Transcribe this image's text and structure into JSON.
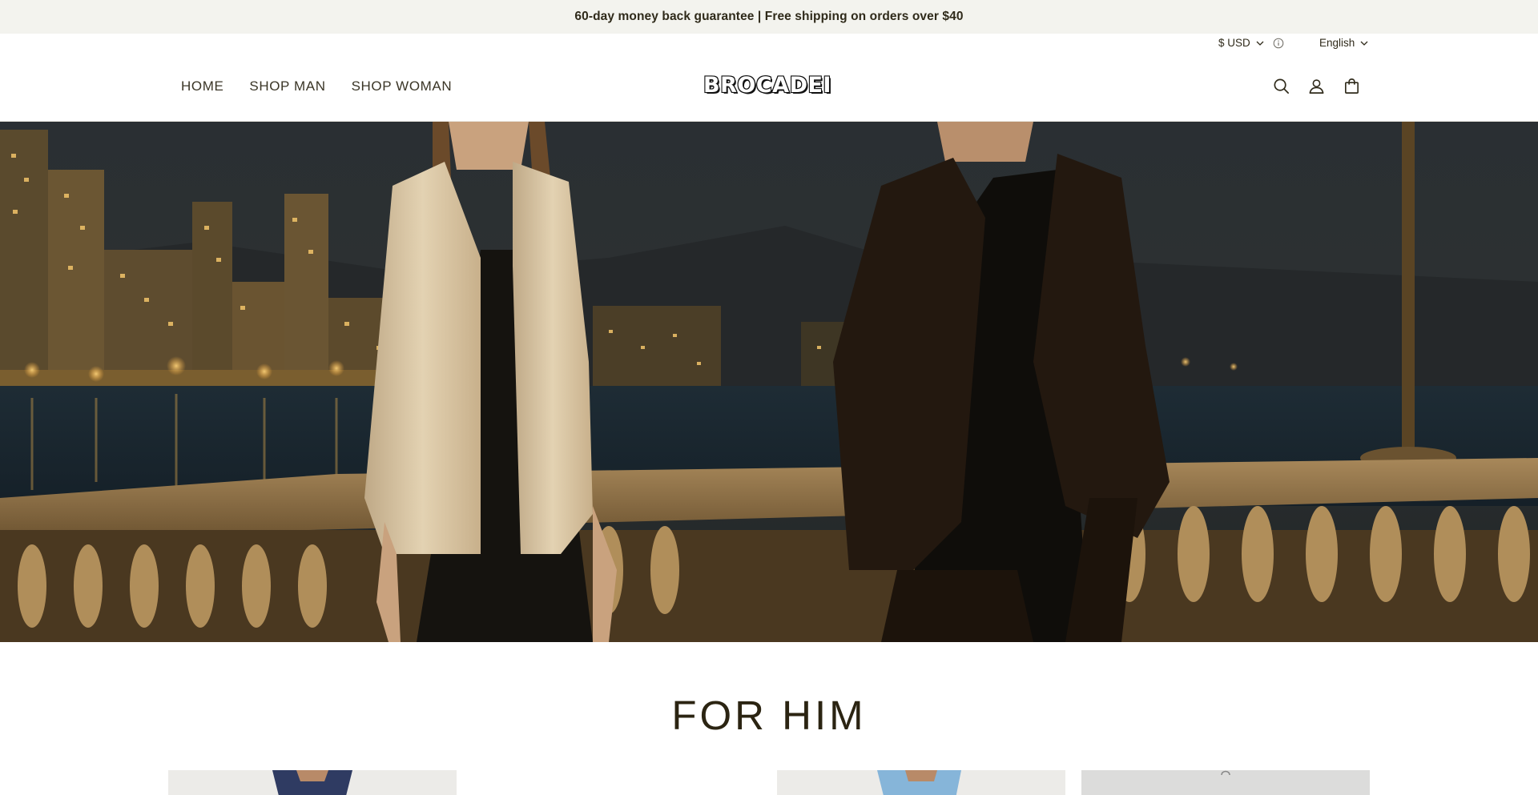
{
  "announcement": {
    "text": "60-day money back guarantee | Free shipping on orders over $40"
  },
  "utility": {
    "currency_label": "$ USD",
    "language_label": "English"
  },
  "nav": {
    "items": [
      {
        "label": "HOME"
      },
      {
        "label": "SHOP MAN"
      },
      {
        "label": "SHOP WOMAN"
      }
    ]
  },
  "brand": {
    "logo_text": "BROCADEI"
  },
  "icons": {
    "search": "search-icon",
    "account": "account-icon",
    "cart": "shopping-bag-icon",
    "currency_chevron": "chevron-down-icon",
    "language_chevron": "chevron-down-icon",
    "info": "info-icon"
  },
  "hero": {
    "scene": "night waterfront city lights with balustrade, woman in cream blazer, man in dark suit"
  },
  "sections": {
    "for_him_title": "FOR HIM"
  },
  "colors": {
    "announcement_bg": "#f3f3ee",
    "text_dark": "#2f2a1a",
    "title": "#2b2412"
  }
}
